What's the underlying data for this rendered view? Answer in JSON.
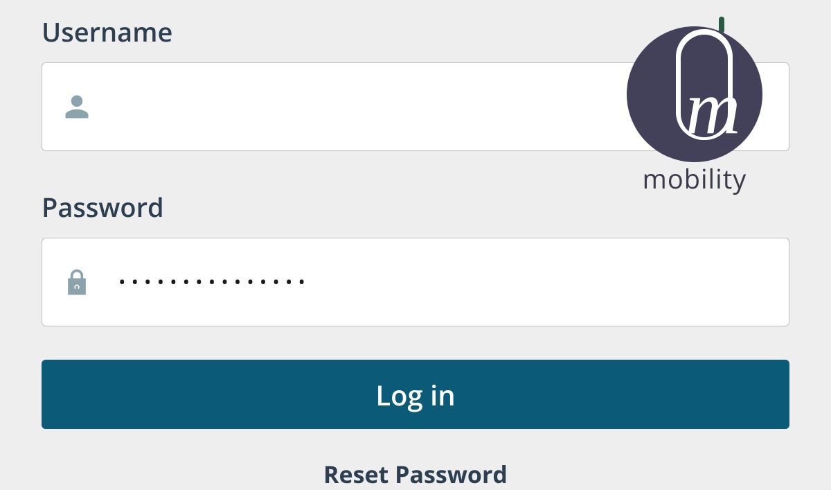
{
  "labels": {
    "username": "Username",
    "password": "Password"
  },
  "fields": {
    "username_value": "",
    "password_value": "•••••••••••••••"
  },
  "buttons": {
    "login": "Log in",
    "reset": "Reset Password"
  },
  "logo": {
    "text": "mobility"
  },
  "colors": {
    "primary_button": "#0b5a78",
    "text_dark": "#2c3e50",
    "icon": "#8aa3ad",
    "logo_dark": "#43405a",
    "logo_accent": "#2a5a43"
  }
}
